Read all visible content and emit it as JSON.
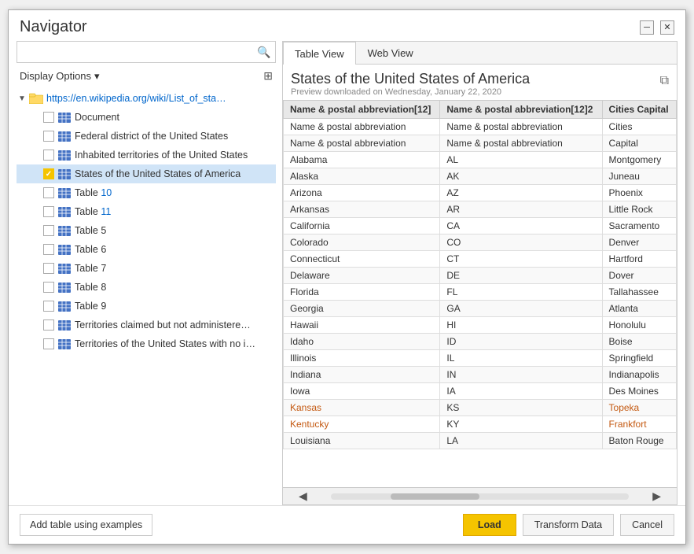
{
  "dialog": {
    "title": "Navigator",
    "minimize_label": "─",
    "close_label": "✕"
  },
  "search": {
    "placeholder": ""
  },
  "display_options": {
    "label": "Display Options",
    "chevron": "▾"
  },
  "tabs": [
    {
      "id": "table",
      "label": "Table View",
      "active": true
    },
    {
      "id": "web",
      "label": "Web View",
      "active": false
    }
  ],
  "preview": {
    "title": "States of the United States of America",
    "subtitle": "Preview downloaded on Wednesday, January 22, 2020"
  },
  "table_columns": [
    "Name & postal abbreviation[12]",
    "Name & postal abbreviation[12]2",
    "Cities Capital"
  ],
  "table_rows": [
    [
      "Name & postal abbreviation",
      "Name & postal abbreviation",
      "Cities"
    ],
    [
      "Name & postal abbreviation",
      "Name & postal abbreviation",
      "Capital"
    ],
    [
      "Alabama",
      "AL",
      "Montgomery"
    ],
    [
      "Alaska",
      "AK",
      "Juneau"
    ],
    [
      "Arizona",
      "AZ",
      "Phoenix"
    ],
    [
      "Arkansas",
      "AR",
      "Little Rock"
    ],
    [
      "California",
      "CA",
      "Sacramento"
    ],
    [
      "Colorado",
      "CO",
      "Denver"
    ],
    [
      "Connecticut",
      "CT",
      "Hartford"
    ],
    [
      "Delaware",
      "DE",
      "Dover"
    ],
    [
      "Florida",
      "FL",
      "Tallahassee"
    ],
    [
      "Georgia",
      "GA",
      "Atlanta"
    ],
    [
      "Hawaii",
      "HI",
      "Honolulu"
    ],
    [
      "Idaho",
      "ID",
      "Boise"
    ],
    [
      "Illinois",
      "IL",
      "Springfield"
    ],
    [
      "Indiana",
      "IN",
      "Indianapolis"
    ],
    [
      "Iowa",
      "IA",
      "Des Moines"
    ],
    [
      "Kansas",
      "KS",
      "Topeka"
    ],
    [
      "Kentucky",
      "KY",
      "Frankfort"
    ],
    [
      "Louisiana",
      "LA",
      "Baton Rouge"
    ]
  ],
  "tree_items": [
    {
      "id": "root",
      "level": 0,
      "type": "root",
      "expand": "▼",
      "label": "https://en.wikipedia.org/wiki/List_of_states_an...",
      "checked": false,
      "is_folder": true
    },
    {
      "id": "document",
      "level": 1,
      "type": "table",
      "label": "Document",
      "checked": false
    },
    {
      "id": "federal",
      "level": 1,
      "type": "table",
      "label": "Federal district of the United States",
      "checked": false
    },
    {
      "id": "inhabited",
      "level": 1,
      "type": "table",
      "label": "Inhabited territories of the United States",
      "checked": false
    },
    {
      "id": "states",
      "level": 1,
      "type": "table",
      "label": "States of the United States of America",
      "checked": true,
      "selected": true
    },
    {
      "id": "table10",
      "level": 1,
      "type": "table",
      "label": "Table 10",
      "checked": false,
      "link": true
    },
    {
      "id": "table11",
      "level": 1,
      "type": "table",
      "label": "Table 11",
      "checked": false,
      "link": true
    },
    {
      "id": "table5",
      "level": 1,
      "type": "table",
      "label": "Table 5",
      "checked": false
    },
    {
      "id": "table6",
      "level": 1,
      "type": "table",
      "label": "Table 6",
      "checked": false
    },
    {
      "id": "table7",
      "level": 1,
      "type": "table",
      "label": "Table 7",
      "checked": false
    },
    {
      "id": "table8",
      "level": 1,
      "type": "table",
      "label": "Table 8",
      "checked": false
    },
    {
      "id": "table9",
      "level": 1,
      "type": "table",
      "label": "Table 9",
      "checked": false
    },
    {
      "id": "territories_claimed",
      "level": 1,
      "type": "table",
      "label": "Territories claimed but not administered b...",
      "checked": false
    },
    {
      "id": "territories_no_inhab",
      "level": 1,
      "type": "table",
      "label": "Territories of the United States with no in...",
      "checked": false
    }
  ],
  "footer": {
    "add_table_label": "Add table using examples",
    "load_label": "Load",
    "transform_label": "Transform Data",
    "cancel_label": "Cancel"
  }
}
